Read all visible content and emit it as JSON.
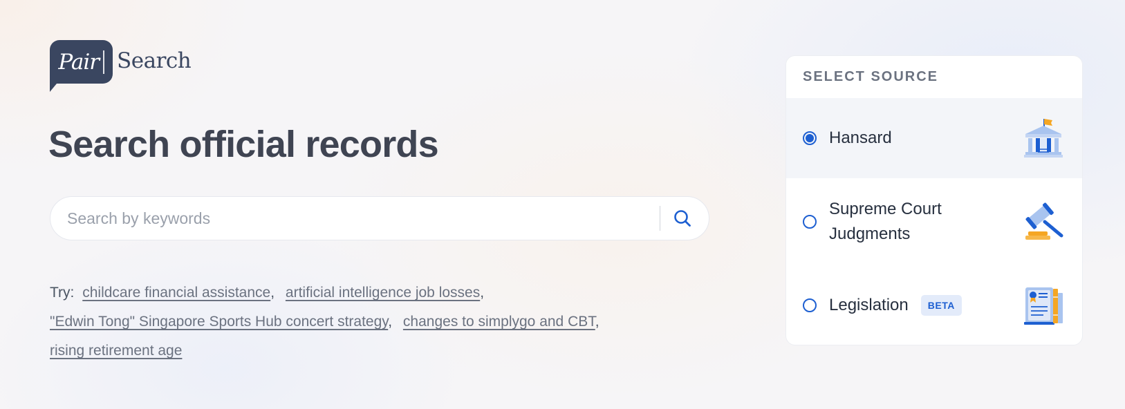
{
  "logo": {
    "badge_text": "Pair",
    "wordmark": "Search"
  },
  "heading": "Search official records",
  "search": {
    "placeholder": "Search by keywords",
    "value": "",
    "button_icon": "search-icon"
  },
  "suggestions": {
    "label": "Try:",
    "items": [
      "childcare financial assistance",
      "artificial intelligence job losses",
      "\"Edwin Tong\" Singapore Sports Hub concert strategy",
      "changes to simplygo and CBT",
      "rising retirement age"
    ]
  },
  "source_panel": {
    "title": "SELECT SOURCE",
    "options": [
      {
        "label": "Hansard",
        "selected": true,
        "icon": "parliament-building-icon"
      },
      {
        "label": "Supreme Court Judgments",
        "selected": false,
        "icon": "gavel-icon"
      },
      {
        "label": "Legislation",
        "selected": false,
        "badge": "BETA",
        "icon": "legal-document-icon"
      }
    ]
  },
  "colors": {
    "accent": "#1d5fd1",
    "logo": "#3a4660",
    "heading": "#3f4452",
    "icon_orange": "#f5a623",
    "icon_light_blue": "#a9c4ef"
  }
}
